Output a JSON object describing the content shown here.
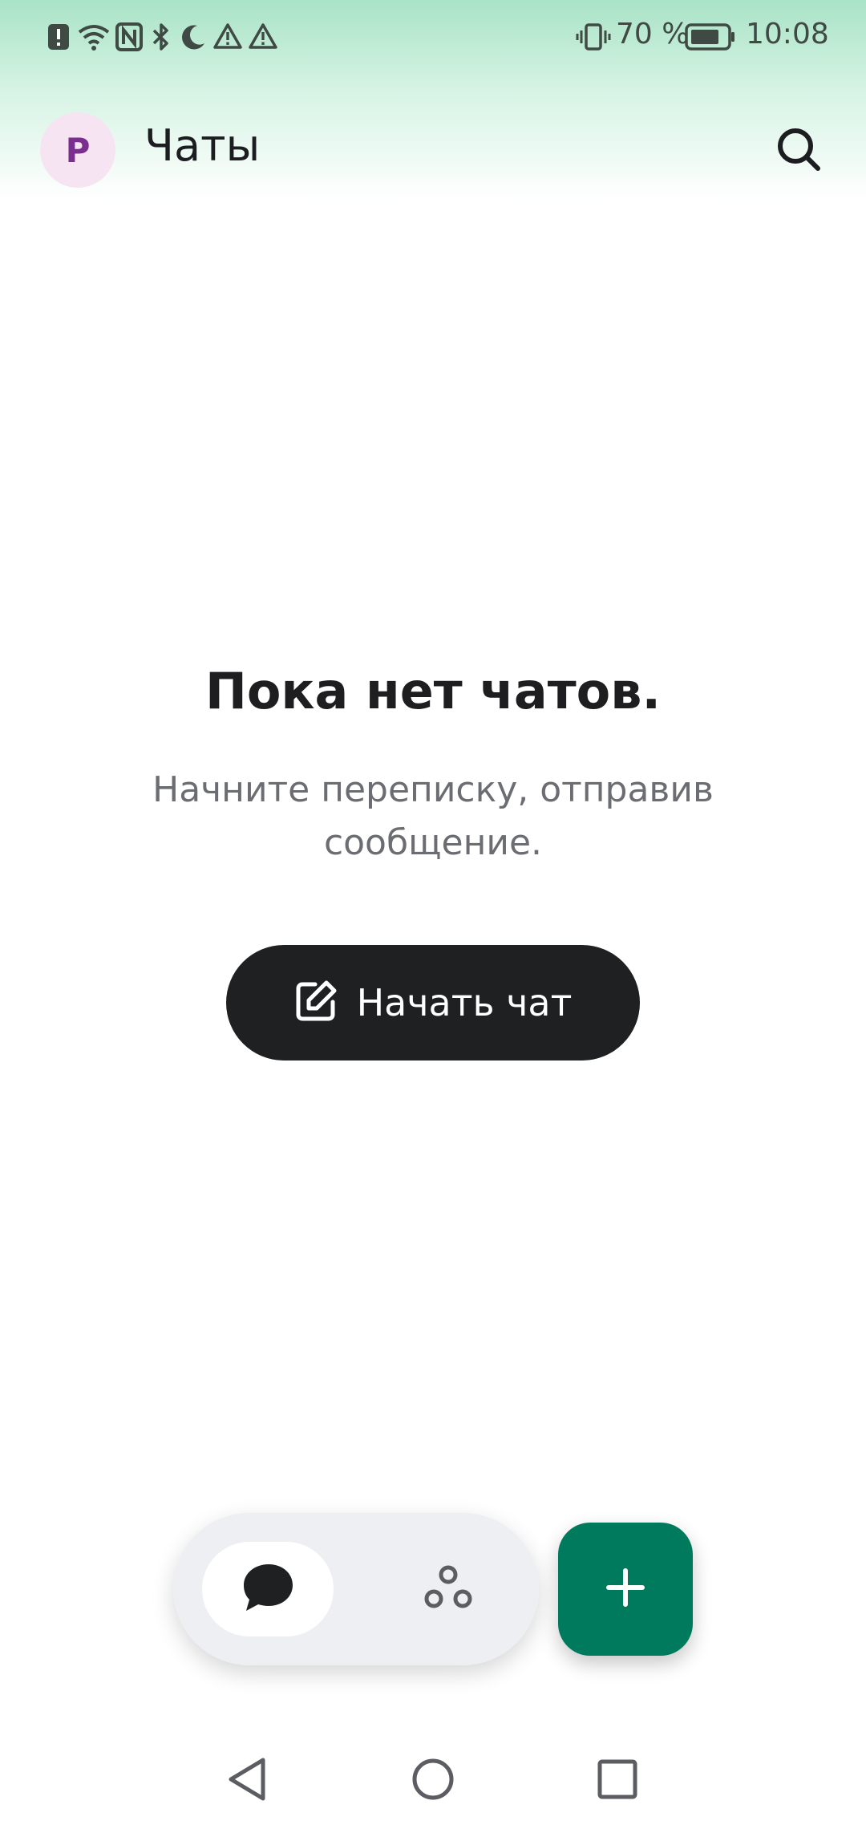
{
  "status_bar": {
    "battery_percent": "70 %",
    "time": "10:08",
    "left_icons": [
      "alert-icon",
      "wifi-icon",
      "nfc-icon",
      "bluetooth-icon",
      "moon-icon",
      "warning-icon",
      "warning-icon"
    ],
    "right_icons": [
      "vibrate-icon",
      "battery-icon"
    ]
  },
  "header": {
    "avatar_letter": "P",
    "title": "Чаты",
    "search_icon": "search-icon"
  },
  "empty_state": {
    "title": "Пока нет чатов.",
    "subtitle": "Начните переписку, отправив сообщение.",
    "button_label": "Начать чат",
    "button_icon": "edit-icon"
  },
  "bottom_nav": {
    "items": [
      {
        "icon": "chat-bubble-icon",
        "selected": true
      },
      {
        "icon": "channels-icon",
        "selected": false
      }
    ],
    "fab_icon": "plus-icon"
  },
  "system_nav": {
    "icons": [
      "back-icon",
      "home-icon",
      "recents-icon"
    ]
  },
  "colors": {
    "accent": "#007a5c",
    "button_dark": "#1f2022",
    "avatar_bg": "#f6e4f2",
    "avatar_text": "#7a2f8e"
  }
}
